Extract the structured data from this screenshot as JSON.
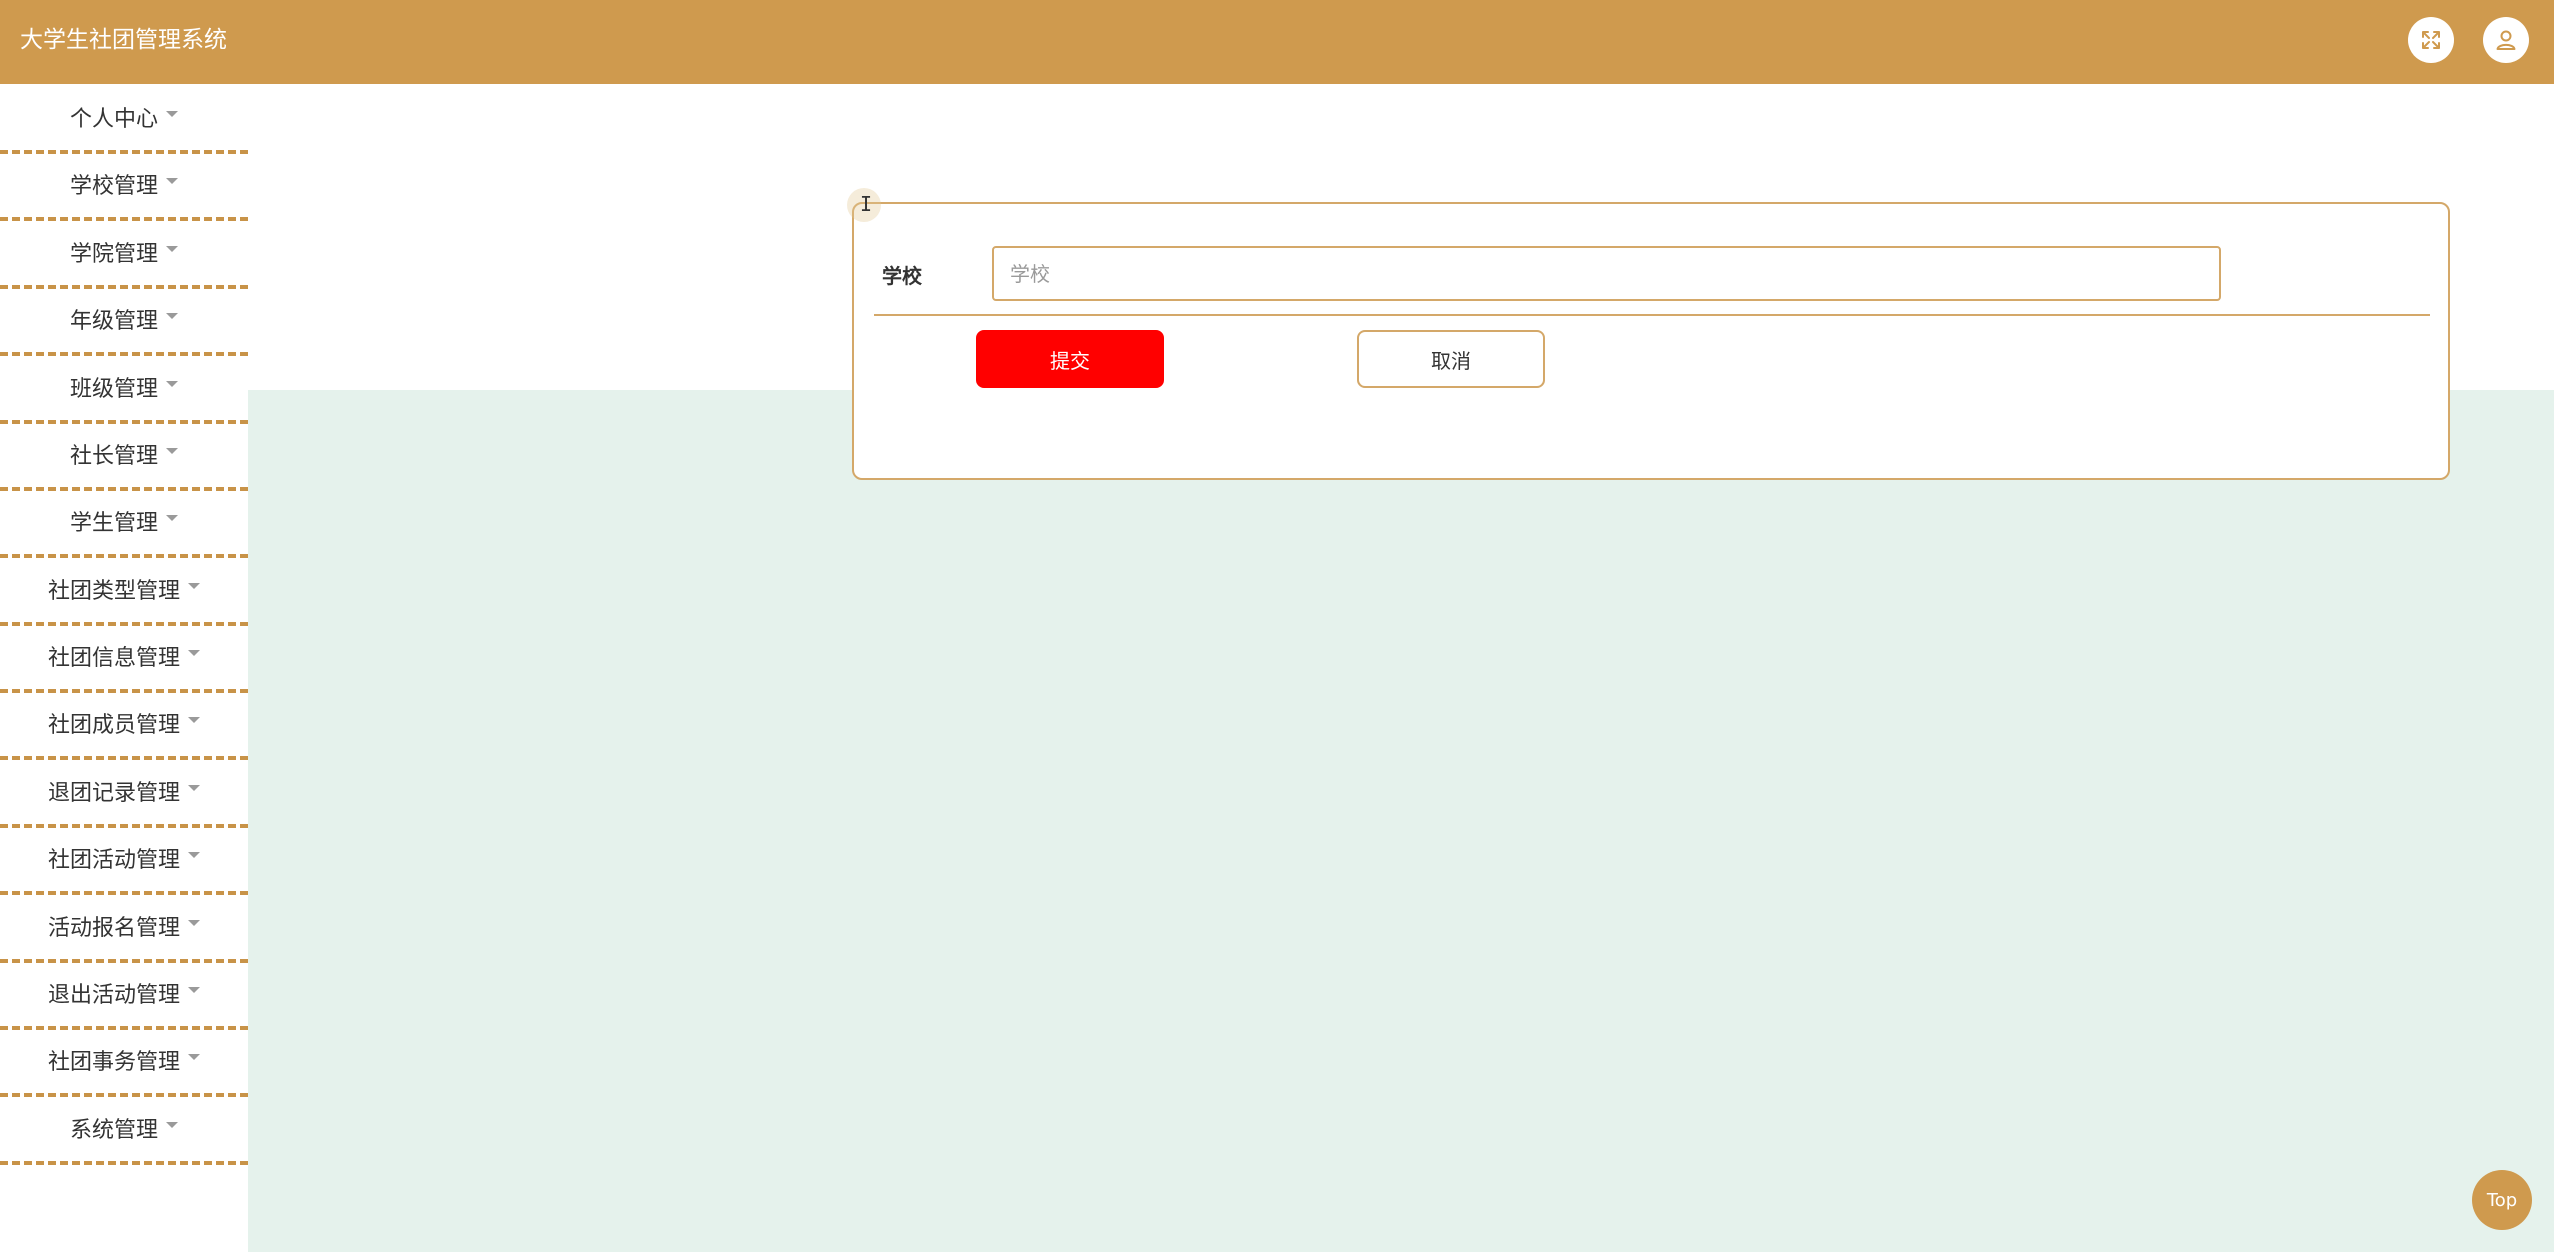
{
  "app": {
    "title": "大学生社团管理系统"
  },
  "header": {
    "fullscreen_icon": "fullscreen-icon",
    "user_icon": "user-icon"
  },
  "sidebar": {
    "items": [
      {
        "label": "个人中心"
      },
      {
        "label": "学校管理"
      },
      {
        "label": "学院管理"
      },
      {
        "label": "年级管理"
      },
      {
        "label": "班级管理"
      },
      {
        "label": "社长管理"
      },
      {
        "label": "学生管理"
      },
      {
        "label": "社团类型管理"
      },
      {
        "label": "社团信息管理"
      },
      {
        "label": "社团成员管理"
      },
      {
        "label": "退团记录管理"
      },
      {
        "label": "社团活动管理"
      },
      {
        "label": "活动报名管理"
      },
      {
        "label": "退出活动管理"
      },
      {
        "label": "社团事务管理"
      },
      {
        "label": "系统管理"
      }
    ]
  },
  "form": {
    "school_label": "学校",
    "school_placeholder": "学校",
    "school_value": "",
    "submit_label": "提交",
    "cancel_label": "取消"
  },
  "back_to_top": {
    "label": "Top"
  },
  "colors": {
    "header_bg": "#cf9a4e",
    "border": "#d4a869",
    "submit_bg": "#ff0000",
    "content_bg": "#e5f2ec"
  }
}
